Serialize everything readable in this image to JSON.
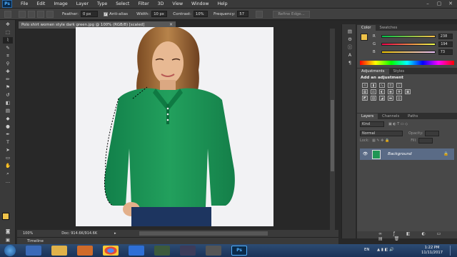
{
  "app": {
    "logo": "Ps"
  },
  "menu": [
    "File",
    "Edit",
    "Image",
    "Layer",
    "Type",
    "Select",
    "Filter",
    "3D",
    "View",
    "Window",
    "Help"
  ],
  "window_controls": [
    "–",
    "▢",
    "✕"
  ],
  "options": {
    "feather_label": "Feather:",
    "feather_value": "0 px",
    "anti_alias_label": "Anti-alias",
    "width_label": "Width:",
    "width_value": "10 px",
    "contrast_label": "Contrast:",
    "contrast_value": "10%",
    "frequency_label": "Frequency:",
    "frequency_value": "57",
    "refine_button": "Refine Edge..."
  },
  "document": {
    "tab_title": "Polo shirt women style dark green.jpg @ 100% (RGB/8) [scaled]",
    "tab_close": "×",
    "zoom": "100%",
    "doc_info": "Doc: 914.6K/914.6K",
    "timeline_label": "Timeline"
  },
  "color_panel": {
    "tabs": [
      "Color",
      "Swatches"
    ],
    "r": "238",
    "g": "194",
    "b": "73",
    "r_label": "R",
    "g_label": "G",
    "b_label": "B",
    "foreground": "#eec249"
  },
  "adjustments_panel": {
    "tabs": [
      "Adjustments",
      "Styles"
    ],
    "heading": "Add an adjustment"
  },
  "layers_panel": {
    "tabs": [
      "Layers",
      "Channels",
      "Paths"
    ],
    "kind_label": "Kind",
    "blend_mode": "Normal",
    "opacity_label": "Opacity:",
    "lock_label": "Lock:",
    "fill_label": "Fill:",
    "layer_name": "Background"
  },
  "taskbar": {
    "language": "EN",
    "time": "1:22 PM",
    "date": "11/11/2017"
  },
  "colors": {
    "shirt": "#1f9655",
    "accent": "#2e6fd6"
  }
}
